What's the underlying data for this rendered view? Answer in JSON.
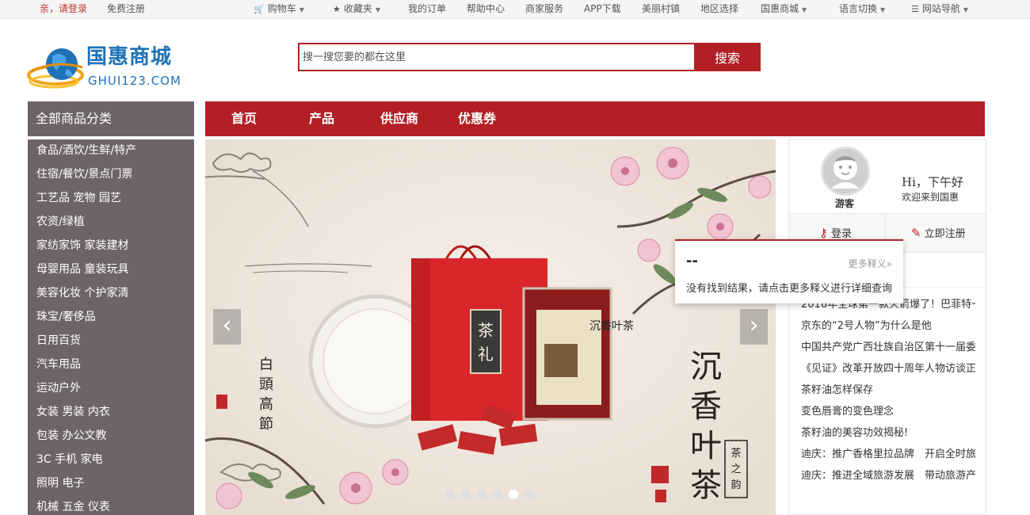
{
  "topbar": {
    "greeting": "亲，请登录",
    "register": "免费注册",
    "cart": "购物车",
    "favorites": "收藏夹",
    "orders": "我的订单",
    "help": "帮助中心",
    "merchant": "商家服务",
    "app": "APP下载",
    "village": "美丽村镇",
    "region": "地区选择",
    "mall": "国惠商城",
    "language": "语言切换",
    "sitenav": "网站导航"
  },
  "logo": {
    "cn": "国惠商城",
    "en": "GHUI123.COM"
  },
  "search": {
    "placeholder": "搜一搜您要的都在这里",
    "button": "搜索"
  },
  "categories": {
    "title": "全部商品分类",
    "items": [
      "食品/酒饮/生鲜/特产",
      "住宿/餐饮/景点门票",
      "工艺品 宠物 园艺",
      "农资/绿植",
      "家纺家饰 家装建材",
      "母婴用品 童装玩具",
      "美容化妆 个护家清",
      "珠宝/奢侈品",
      "日用百货",
      "汽车用品",
      "运动户外",
      "女装 男装 内衣",
      "包装 办公文教",
      "3C 手机 家电",
      "照明 电子",
      "机械 五金 仪表"
    ]
  },
  "nav": {
    "items": [
      "首页",
      "产品",
      "供应商",
      "优惠券"
    ]
  },
  "banner": {
    "slide_count": 6,
    "active_slide": 5,
    "bag_label": "茶礼",
    "pack_label": "沉香叶茶",
    "calligraphy": "沉香叶茶",
    "poem": "白头高节",
    "seal": "茶之韵"
  },
  "user": {
    "name": "游客",
    "greeting": "Hi，下午好",
    "welcome": "欢迎来到国惠",
    "login": "登录",
    "register": "立即注册"
  },
  "news": {
    "items": [
      "2018年全球第一款火箭爆了！巴菲特一",
      "京东的“2号人物”为什么是他",
      "中国共产党广西壮族自治区第十一届委",
      "《见证》改革开放四十周年人物访谈正",
      "茶籽油怎样保存",
      "变色唇膏的变色理念",
      "茶籽油的美容功效揭秘!",
      "迪庆：推广香格里拉品牌　开启全时旅",
      "迪庆：推进全域旅游发展　带动旅游产"
    ]
  },
  "popup": {
    "word": "--",
    "more": "更多释义»",
    "message": "没有找到结果，请点击更多释义进行详细查询"
  },
  "colors": {
    "brand_red": "#b21f24",
    "sidebar": "#6e6465",
    "logo_blue": "#1e72b8"
  }
}
